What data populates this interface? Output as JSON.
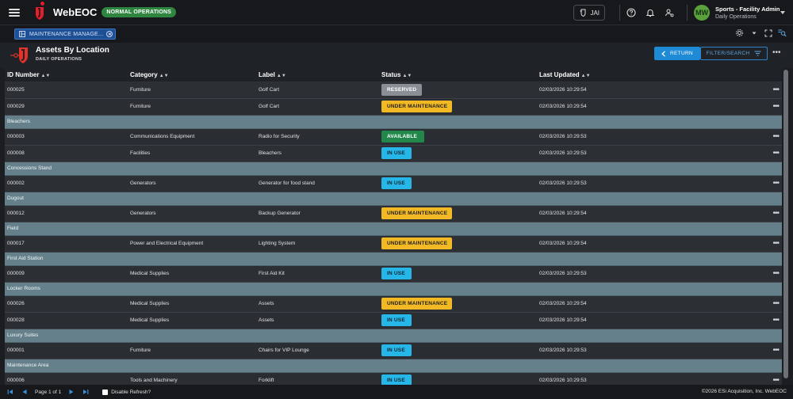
{
  "app": {
    "name": "WebEOC",
    "ops_status": "NORMAL OPERATIONS",
    "status_color": "#2e8540"
  },
  "topbar": {
    "jai_label": "JAI",
    "icons": [
      "help-icon",
      "bell-icon",
      "user-switch-icon"
    ],
    "user": {
      "initials": "MW",
      "name": "Sports - Facility Admin",
      "position": "Daily Operations"
    }
  },
  "tab": {
    "label": "MAINTENANCE MANAGE..."
  },
  "board": {
    "title": "Assets By Location",
    "subtitle": "DAILY OPERATIONS",
    "return_label": "RETURN",
    "filter_label": "FILTER/SEARCH"
  },
  "table": {
    "columns": [
      "ID Number",
      "Category",
      "Label",
      "Status",
      "Last Updated"
    ],
    "rows": [
      {
        "type": "data",
        "id": "000025",
        "category": "Furniture",
        "label": "Golf Cart",
        "status": "RESERVED",
        "updated": "02/03/2026 10:29:54"
      },
      {
        "type": "data",
        "id": "000029",
        "category": "Furniture",
        "label": "Golf Cart",
        "status": "UNDER MAINTENANCE",
        "updated": "02/03/2026 10:29:54"
      },
      {
        "type": "group",
        "name": "Bleachers"
      },
      {
        "type": "data",
        "id": "000003",
        "category": "Communications Equipment",
        "label": "Radio for Security",
        "status": "AVAILABLE",
        "updated": "02/03/2026 10:29:53"
      },
      {
        "type": "data",
        "id": "000008",
        "category": "Facilities",
        "label": "Bleachers",
        "status": "IN USE",
        "updated": "02/03/2026 10:29:53"
      },
      {
        "type": "group",
        "name": "Concessions Stand"
      },
      {
        "type": "data",
        "id": "000002",
        "category": "Generators",
        "label": "Generator for food stand",
        "status": "IN USE",
        "updated": "02/03/2026 10:29:53"
      },
      {
        "type": "group",
        "name": "Dugout"
      },
      {
        "type": "data",
        "id": "000012",
        "category": "Generators",
        "label": "Backup Generator",
        "status": "UNDER MAINTENANCE",
        "updated": "02/03/2026 10:29:54"
      },
      {
        "type": "group",
        "name": "Field"
      },
      {
        "type": "data",
        "id": "000017",
        "category": "Power and Electrical Equipment",
        "label": "Lighting System",
        "status": "UNDER MAINTENANCE",
        "updated": "02/03/2026 10:29:54"
      },
      {
        "type": "group",
        "name": "First Aid Station"
      },
      {
        "type": "data",
        "id": "000009",
        "category": "Medical Supplies",
        "label": "First Aid Kit",
        "status": "IN USE",
        "updated": "02/03/2026 10:29:53"
      },
      {
        "type": "group",
        "name": "Locker Rooms"
      },
      {
        "type": "data",
        "id": "000026",
        "category": "Medical Supplies",
        "label": "Assets",
        "status": "UNDER MAINTENANCE",
        "updated": "02/03/2026 10:29:54"
      },
      {
        "type": "data",
        "id": "000028",
        "category": "Medical Supplies",
        "label": "Assets",
        "status": "IN USE",
        "updated": "02/03/2026 10:29:54"
      },
      {
        "type": "group",
        "name": "Luxury Suites"
      },
      {
        "type": "data",
        "id": "000001",
        "category": "Furniture",
        "label": "Chairs for VIP Lounge",
        "status": "IN USE",
        "updated": "02/03/2026 10:29:53"
      },
      {
        "type": "group",
        "name": "Maintenance Area"
      },
      {
        "type": "data",
        "id": "000006",
        "category": "Tools and Machinery",
        "label": "Forklift",
        "status": "IN USE",
        "updated": "02/03/2026 10:29:53"
      }
    ]
  },
  "status_colors": {
    "RESERVED": "#8a8f96",
    "UNDER MAINTENANCE": "#f2b925",
    "AVAILABLE": "#22874a",
    "IN USE": "#26b6e8"
  },
  "footer": {
    "page_text": "Page 1 of 1",
    "disable_refresh_label": "Disable Refresh?",
    "copyright": "©2026 ESi Acquisition, Inc. WebEOC"
  }
}
